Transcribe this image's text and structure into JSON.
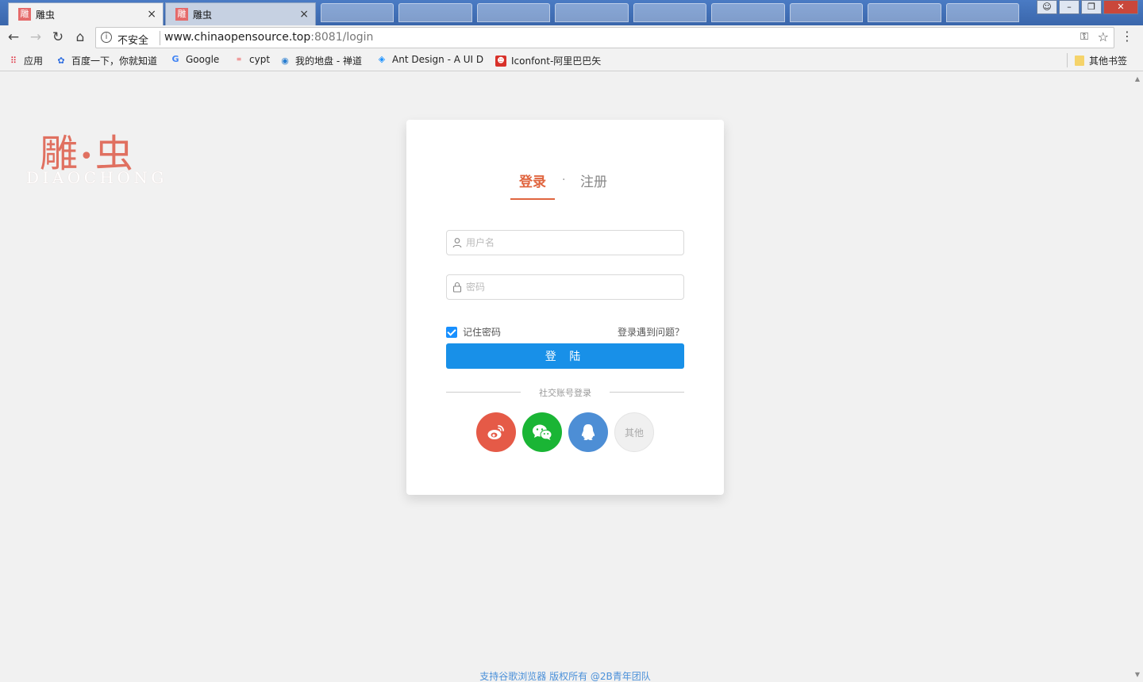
{
  "browser": {
    "tabs": [
      {
        "favicon": "雕",
        "title": "雕虫",
        "close": "×"
      },
      {
        "favicon": "雕",
        "title": "雕虫",
        "close": "×"
      }
    ],
    "window_buttons": {
      "minimize": "–",
      "restore": "❐",
      "close": "✕"
    },
    "nav": {
      "back": "←",
      "forward": "→",
      "reload": "↻",
      "home": "⌂"
    },
    "address": {
      "security": "不安全",
      "host": "www.chinaopensource.top",
      "path": ":8081/login"
    },
    "bookmarks": [
      {
        "icon": "apps-icon",
        "label": "应用"
      },
      {
        "icon": "baidu-icon",
        "label": "百度一下，你就知道"
      },
      {
        "icon": "google-icon",
        "label": "Google"
      },
      {
        "icon": "cypt-icon",
        "label": "cypt"
      },
      {
        "icon": "globe-icon",
        "label": "我的地盘 - 禅道"
      },
      {
        "icon": "ant-design-icon",
        "label": "Ant Design - A UI D"
      },
      {
        "icon": "iconfont-icon",
        "label": "Iconfont-阿里巴巴矢"
      }
    ],
    "other_bookmarks": "其他书签"
  },
  "logo": {
    "cn_left": "雕",
    "dot": "•",
    "cn_right": "虫",
    "en": "DIAOCHONG"
  },
  "auth": {
    "tab_login": "登录",
    "tab_separator": "·",
    "tab_register": "注册",
    "username_placeholder": "用户名",
    "password_placeholder": "密码",
    "remember_label": "记住密码",
    "remember_checked": true,
    "trouble_link": "登录遇到问题？",
    "login_button": "登 陆",
    "social_label": "社交账号登录",
    "social": [
      {
        "name": "weibo",
        "icon": "weibo-icon",
        "color": "#e55a47"
      },
      {
        "name": "wechat",
        "icon": "wechat-icon",
        "color": "#1ab535"
      },
      {
        "name": "qq",
        "icon": "qq-icon",
        "color": "#4d8ed5"
      }
    ],
    "other_label": "其他"
  },
  "footer": "支持谷歌浏览器 版权所有 @2B青年团队",
  "colors": {
    "accent": "#e0653f",
    "primary": "#1890e8",
    "background": "#f1f1f1"
  }
}
